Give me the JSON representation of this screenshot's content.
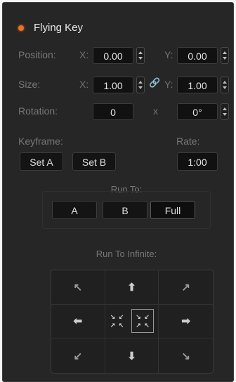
{
  "header": {
    "title": "Flying Key",
    "indicator_color": "#e8741e"
  },
  "position": {
    "label": "Position:",
    "x_label": "X:",
    "x_value": "0.00",
    "y_label": "Y:",
    "y_value": "0.00"
  },
  "size": {
    "label": "Size:",
    "x_label": "X:",
    "x_value": "1.00",
    "y_label": "Y:",
    "y_value": "1.00",
    "link_icon": "chain-link-icon"
  },
  "rotation": {
    "label": "Rotation:",
    "value": "0",
    "separator": "x",
    "angle": "0°"
  },
  "keyframe": {
    "label": "Keyframe:",
    "set_a": "Set A",
    "set_b": "Set B"
  },
  "rate": {
    "label": "Rate:",
    "value": "1:00"
  },
  "run_to": {
    "title": "Run To:",
    "a": "A",
    "b": "B",
    "full": "Full"
  },
  "run_to_infinite": {
    "title": "Run To Infinite:",
    "arrows": [
      "up-left-arrow-icon",
      "up-arrow-icon",
      "up-right-arrow-icon",
      "left-arrow-icon",
      "center-icon",
      "right-arrow-icon",
      "down-left-arrow-icon",
      "down-arrow-icon",
      "down-right-arrow-icon"
    ]
  }
}
